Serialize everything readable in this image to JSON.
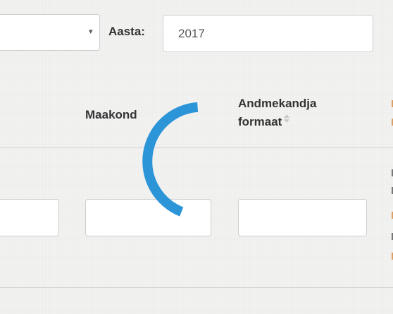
{
  "filters": {
    "year_label": "Aasta:",
    "year_value": "2017",
    "select_caret": "▾"
  },
  "table": {
    "headers": {
      "maakond": "Maakond",
      "formaat_line1": "Andmekandja",
      "formaat_line2": "formaat"
    }
  },
  "loading": {
    "spinner_color": "#2b95d8"
  }
}
